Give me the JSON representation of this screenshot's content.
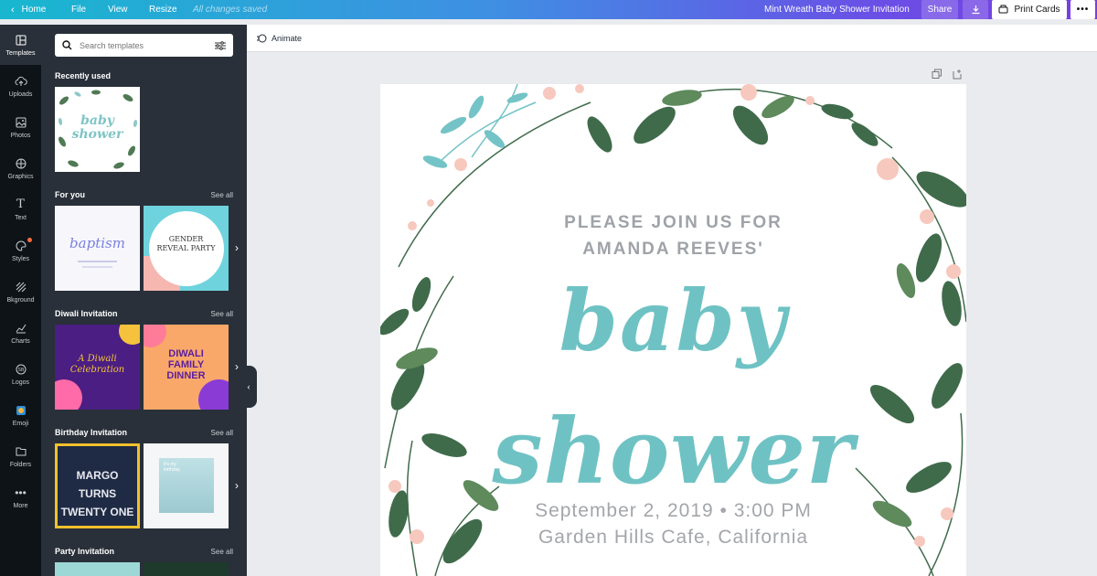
{
  "topbar": {
    "home_label": "Home",
    "file_label": "File",
    "view_label": "View",
    "resize_label": "Resize",
    "save_status": "All changes saved",
    "document_title": "Mint Wreath Baby Shower Invitation",
    "share_label": "Share",
    "print_label": "Print Cards",
    "more_label": "•••",
    "download_icon": "download-icon"
  },
  "rail": {
    "items": [
      {
        "label": "Templates",
        "icon": "templates-icon"
      },
      {
        "label": "Uploads",
        "icon": "upload-cloud-icon"
      },
      {
        "label": "Photos",
        "icon": "photo-icon"
      },
      {
        "label": "Graphics",
        "icon": "graphics-icon"
      },
      {
        "label": "Text",
        "icon": "text-icon"
      },
      {
        "label": "Styles",
        "icon": "palette-icon"
      },
      {
        "label": "Bkground",
        "icon": "background-icon"
      },
      {
        "label": "Charts",
        "icon": "chart-icon"
      },
      {
        "label": "Logos",
        "icon": "logo-icon"
      },
      {
        "label": "Emoji",
        "icon": "emoji-icon"
      },
      {
        "label": "Folders",
        "icon": "folder-icon"
      },
      {
        "label": "More",
        "icon": "more-icon"
      }
    ]
  },
  "panel": {
    "search_placeholder": "Search templates",
    "see_all": "See all",
    "sections": [
      {
        "title": "Recently used"
      },
      {
        "title": "For you"
      },
      {
        "title": "Diwali Invitation"
      },
      {
        "title": "Birthday Invitation"
      },
      {
        "title": "Party Invitation"
      }
    ],
    "thumbs": {
      "recent": {
        "line1": "baby",
        "line2": "shower"
      },
      "baptism": "baptism",
      "gender": {
        "line1": "GENDER",
        "line2": "REVEAL PARTY"
      },
      "diwali1": {
        "line1": "A Diwali",
        "line2": "Celebration"
      },
      "diwali2": {
        "line1": "DIWALI",
        "line2": "FAMILY",
        "line3": "DINNER"
      },
      "birthday1": {
        "line1": "MARGO TURNS",
        "line2": "TWENTY ONE"
      },
      "birthday2": {
        "line1": "it's my",
        "line2": "birthday"
      }
    }
  },
  "toolbar": {
    "animate_label": "Animate"
  },
  "canvas": {
    "line1": "PLEASE JOIN US FOR",
    "line2": "AMANDA REEVES'",
    "baby": "baby",
    "shower": "shower",
    "date": "September 2, 2019  •  3:00 PM",
    "venue": "Garden Hills Cafe, California",
    "colors": {
      "mint": "#6fc2c4",
      "gray_text": "#9fa3a8",
      "leaf_dark": "#3f6b4a",
      "leaf_mid": "#5e8a5c",
      "teal_leaf": "#74c3c7",
      "pink": "#f7c8bd"
    }
  }
}
